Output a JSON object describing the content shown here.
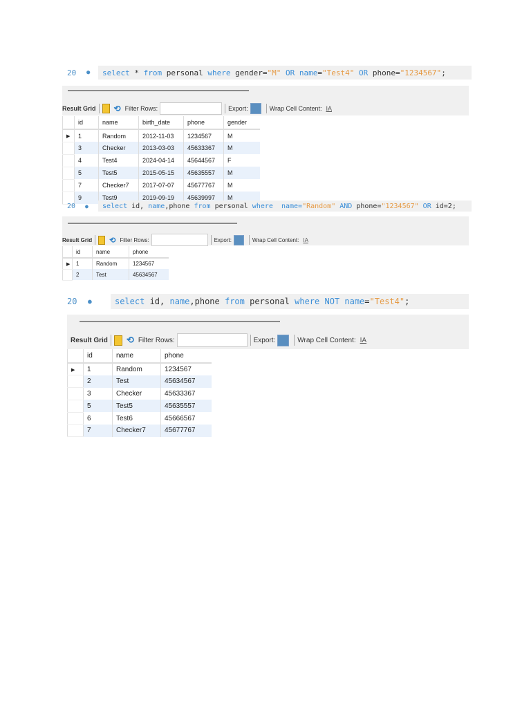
{
  "panels": [
    {
      "line_no": "20",
      "query": [
        [
          "select",
          "kw"
        ],
        [
          " * ",
          "id"
        ],
        [
          "from",
          "kw"
        ],
        [
          " personal ",
          "id"
        ],
        [
          "where",
          "kw"
        ],
        [
          " gender=",
          "id"
        ],
        [
          "\"M\"",
          "str"
        ],
        [
          " OR ",
          "kw"
        ],
        [
          "name",
          "kw"
        ],
        [
          "=",
          "id"
        ],
        [
          "\"Test4\"",
          "str"
        ],
        [
          " OR ",
          "kw"
        ],
        [
          "phone=",
          "id"
        ],
        [
          "\"1234567\"",
          "str"
        ],
        [
          ";",
          "id"
        ]
      ],
      "toolbar": {
        "result_grid": "Result Grid",
        "filter_rows": "Filter Rows:",
        "filter_value": "",
        "export": "Export:",
        "wrap": "Wrap Cell Content:"
      },
      "columns": [
        "id",
        "name",
        "birth_date",
        "phone",
        "gender"
      ],
      "rows": [
        [
          "1",
          "Random",
          "2012-11-03",
          "1234567",
          "M"
        ],
        [
          "3",
          "Checker",
          "2013-03-03",
          "45633367",
          "M"
        ],
        [
          "4",
          "Test4",
          "2024-04-14",
          "45644567",
          "F"
        ],
        [
          "5",
          "Test5",
          "2015-05-15",
          "45635557",
          "M"
        ],
        [
          "7",
          "Checker7",
          "2017-07-07",
          "45677767",
          "M"
        ],
        [
          "9",
          "Test9",
          "2019-09-19",
          "45639997",
          "M"
        ]
      ]
    },
    {
      "line_no": "20",
      "query": [
        [
          "select",
          "kw"
        ],
        [
          " id, ",
          "id"
        ],
        [
          "name",
          "kw"
        ],
        [
          ",phone ",
          "id"
        ],
        [
          "from",
          "kw"
        ],
        [
          " personal ",
          "id"
        ],
        [
          "where",
          "kw"
        ],
        [
          "  name=",
          "kw"
        ],
        [
          "\"Random\"",
          "str"
        ],
        [
          " AND ",
          "kw"
        ],
        [
          "phone=",
          "id"
        ],
        [
          "\"1234567\"",
          "str"
        ],
        [
          " OR ",
          "kw"
        ],
        [
          "id=2;",
          "id"
        ]
      ],
      "toolbar": {
        "result_grid": "Result Grid",
        "filter_rows": "Filter Rows:",
        "filter_value": "",
        "export": "Export:",
        "wrap": "Wrap Cell Content:"
      },
      "columns": [
        "id",
        "name",
        "phone"
      ],
      "rows": [
        [
          "1",
          "Random",
          "1234567"
        ],
        [
          "2",
          "Test",
          "45634567"
        ]
      ]
    },
    {
      "line_no": "20",
      "query": [
        [
          "select",
          "kw"
        ],
        [
          " id, ",
          "id"
        ],
        [
          "name",
          "kw"
        ],
        [
          ",phone ",
          "id"
        ],
        [
          "from",
          "kw"
        ],
        [
          " personal ",
          "id"
        ],
        [
          "where NOT name",
          "kw"
        ],
        [
          "=",
          "id"
        ],
        [
          "\"Test4\"",
          "str"
        ],
        [
          ";",
          "id"
        ]
      ],
      "toolbar": {
        "result_grid": "Result Grid",
        "filter_rows": "Filter Rows:",
        "filter_value": "",
        "export": "Export:",
        "wrap": "Wrap Cell Content:"
      },
      "columns": [
        "id",
        "name",
        "phone"
      ],
      "rows": [
        [
          "1",
          "Random",
          "1234567"
        ],
        [
          "2",
          "Test",
          "45634567"
        ],
        [
          "3",
          "Checker",
          "45633367"
        ],
        [
          "5",
          "Test5",
          "45635557"
        ],
        [
          "6",
          "Test6",
          "45666567"
        ],
        [
          "7",
          "Checker7",
          "45677767"
        ]
      ]
    }
  ]
}
